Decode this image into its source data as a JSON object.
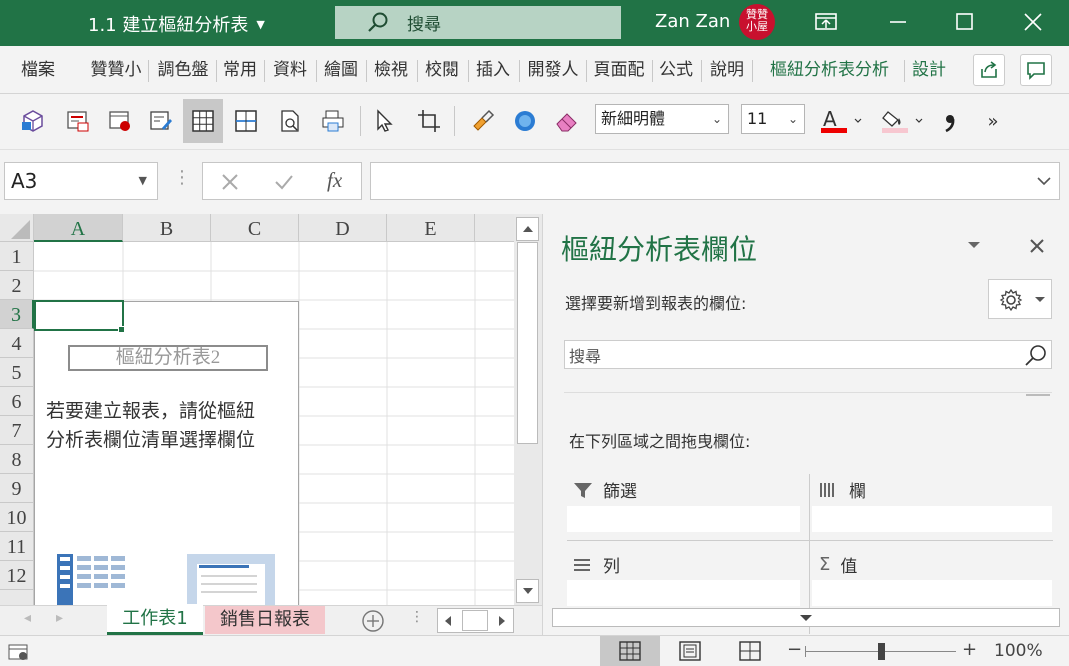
{
  "window": {
    "title": "1.1 建立樞紐分析表",
    "search_placeholder": "搜尋",
    "user_name": "Zan Zan",
    "avatar_text": "贊贊小屋"
  },
  "ribbon": {
    "tabs": [
      "檔案",
      "贊贊小",
      "調色盤",
      "常用",
      "資料",
      "繪圖",
      "檢視",
      "校閱",
      "插入",
      "開發人",
      "頁面配",
      "公式",
      "說明",
      "樞紐分析表分析",
      "設計"
    ]
  },
  "toolbar": {
    "font_name": "新細明體",
    "font_size": "11",
    "more": "»"
  },
  "formula": {
    "name_box": "A3",
    "fx": "fx",
    "value": ""
  },
  "grid": {
    "columns": [
      "A",
      "B",
      "C",
      "D",
      "E"
    ],
    "rows": [
      "1",
      "2",
      "3",
      "4",
      "5",
      "6",
      "7",
      "8",
      "9",
      "10",
      "11",
      "12"
    ]
  },
  "pivot_placeholder": {
    "name": "樞紐分析表2",
    "instruction_line1": "若要建立報表，請從樞紐",
    "instruction_line2": "分析表欄位清單選擇欄位"
  },
  "sheets": {
    "tabs": [
      "工作表1",
      "銷售日報表"
    ]
  },
  "panel": {
    "title": "樞紐分析表欄位",
    "choose_label": "選擇要新增到報表的欄位:",
    "search_placeholder": "搜尋",
    "drag_label": "在下列區域之間拖曳欄位:",
    "areas": {
      "filters": "篩選",
      "columns": "欄",
      "rows": "列",
      "values": "值"
    }
  },
  "status": {
    "zoom": "100%",
    "zoom_minus": "−",
    "zoom_plus": "+",
    "zoom_percent": 50
  },
  "colors": {
    "accent": "#217346",
    "sheet_tab_pink": "#f4c7cb",
    "selection": "#217346"
  }
}
